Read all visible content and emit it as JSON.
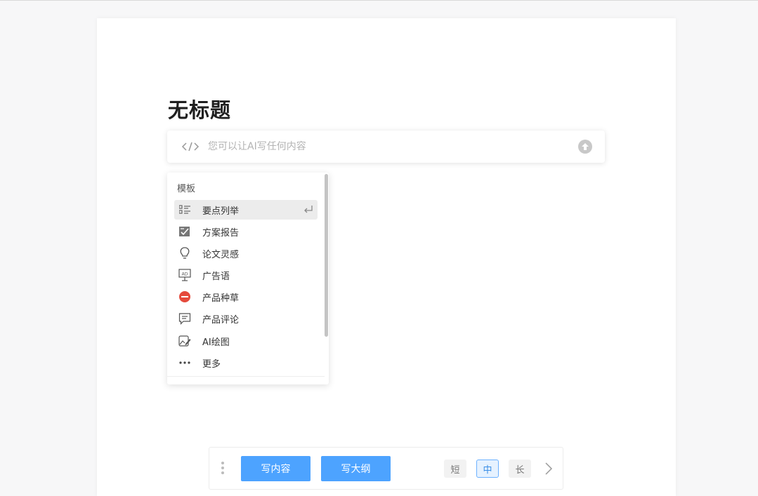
{
  "document": {
    "title": "无标题"
  },
  "ai_bar": {
    "placeholder": "您可以让AI写任何内容",
    "icon": "code-icon",
    "send_icon": "arrow-up-icon"
  },
  "template_menu": {
    "header": "模板",
    "items": [
      {
        "label": "要点列举",
        "icon": "bullet-list-icon",
        "active": true
      },
      {
        "label": "方案报告",
        "icon": "report-icon"
      },
      {
        "label": "论文灵感",
        "icon": "lightbulb-icon"
      },
      {
        "label": "广告语",
        "icon": "ad-board-icon"
      },
      {
        "label": "产品种草",
        "icon": "xiaohongshu-icon"
      },
      {
        "label": "产品评论",
        "icon": "comment-icon"
      },
      {
        "label": "AI绘图",
        "icon": "image-edit-icon"
      },
      {
        "label": "更多",
        "icon": "more-dots-icon"
      }
    ],
    "enter_icon": "enter-key-icon"
  },
  "toolbar": {
    "write_content": "写内容",
    "write_outline": "写大纲",
    "length_options": [
      {
        "label": "短"
      },
      {
        "label": "中",
        "selected": true
      },
      {
        "label": "长"
      }
    ],
    "next_icon": "chevron-right-icon"
  },
  "colors": {
    "accent": "#4da3ff",
    "badge_red": "#e54a3c"
  }
}
